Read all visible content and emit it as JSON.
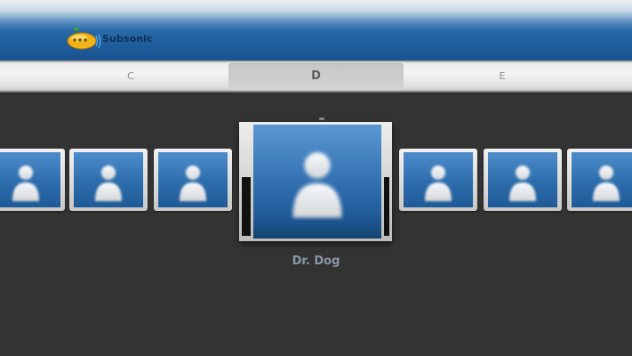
{
  "app": {
    "name": "Subsonic",
    "logo_icon": "submarine-icon"
  },
  "tabs": [
    {
      "label": "C",
      "active": false
    },
    {
      "label": "D",
      "active": true
    },
    {
      "label": "E",
      "active": false
    }
  ],
  "carousel": {
    "selected_title": "Dr. Dog",
    "placeholder_icon": "person-placeholder-icon",
    "item_count": 7,
    "selected_index": 3
  },
  "colors": {
    "header_blue": "#1f5d9c",
    "background": "#333333",
    "caption": "#8a97a8"
  }
}
